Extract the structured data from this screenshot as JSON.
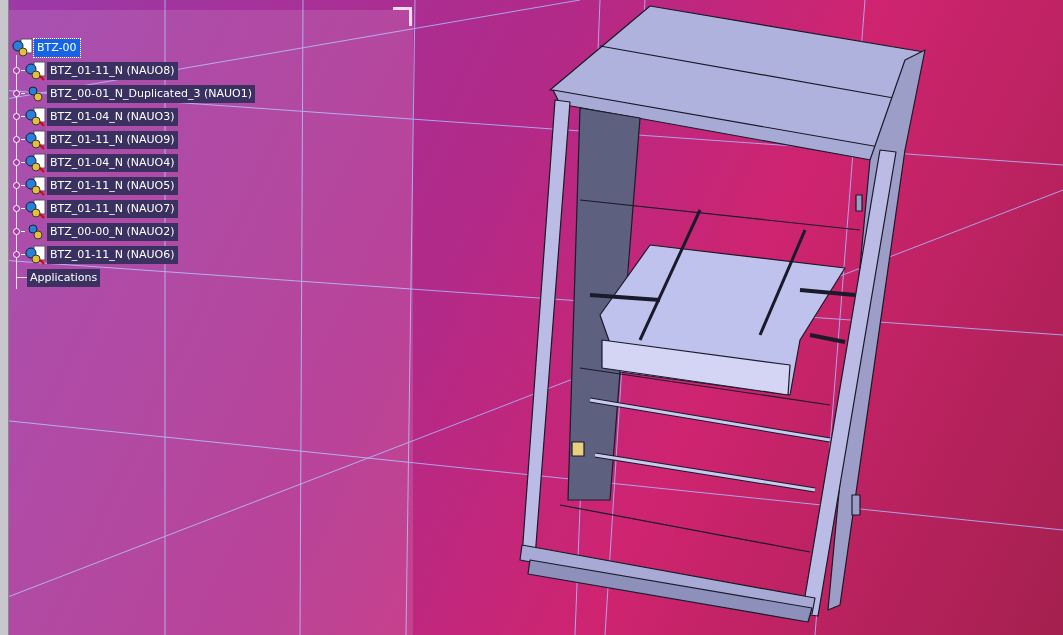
{
  "tree": {
    "root": {
      "label": "BTZ-00",
      "selected": true
    },
    "items": [
      {
        "label": "BTZ_01-11_N (NAUO8)",
        "kind": "product"
      },
      {
        "label": "BTZ_00-01_N_Duplicated_3 (NAUO1)",
        "kind": "component"
      },
      {
        "label": "BTZ_01-04_N (NAUO3)",
        "kind": "product"
      },
      {
        "label": "BTZ_01-11_N (NAUO9)",
        "kind": "product"
      },
      {
        "label": "BTZ_01-04_N (NAUO4)",
        "kind": "product"
      },
      {
        "label": "BTZ_01-11_N (NAUO5)",
        "kind": "product"
      },
      {
        "label": "BTZ_01-11_N (NAUO7)",
        "kind": "product"
      },
      {
        "label": "BTZ_00-00_N (NAUO2)",
        "kind": "component"
      },
      {
        "label": "BTZ_01-11_N (NAUO6)",
        "kind": "product"
      }
    ],
    "applications": "Applications"
  }
}
